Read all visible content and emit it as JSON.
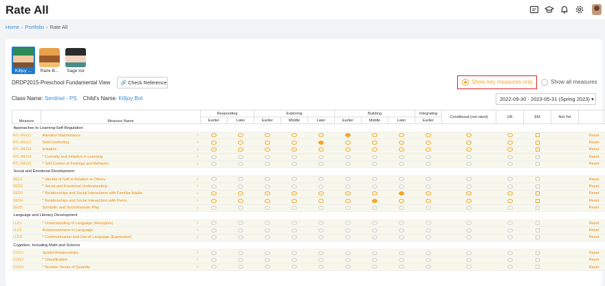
{
  "app": {
    "title": "Rate All"
  },
  "breadcrumb": [
    "Home",
    "Portfolio",
    "Rate All"
  ],
  "children": [
    {
      "name": "Killjoy ...",
      "selected": true
    },
    {
      "name": "Raze B...",
      "selected": false
    },
    {
      "name": "Sage Ice",
      "selected": false
    }
  ],
  "view": {
    "title": "DRDP2015-Preschool Fundamental View",
    "check_reference": "Check Reference"
  },
  "options": {
    "key_only": "Show key measures only",
    "all": "Show all measures"
  },
  "class": {
    "label": "Class Name:",
    "value": "Sentinel - PS",
    "child_label": "Child's Name:",
    "child_value": "Killjoy Bot"
  },
  "date_range": "2022-09-30 - 2023-05-31 (Spring 2023)",
  "table": {
    "groups": [
      "Responding",
      "Exploring",
      "Building",
      "Integrating"
    ],
    "headers": {
      "measure": "Measure",
      "measure_name": "Measure Name",
      "earlier": "Earlier",
      "later": "Later",
      "middle": "Middle",
      "conditional": "Conditional (not rated)",
      "ur": "UR",
      "em": "EM",
      "not_yet": "Not Yet"
    },
    "reset_label": "Reset",
    "sections": [
      {
        "title": "Approaches to Learning-Self-Regulation",
        "rows": [
          {
            "code": "ATL-REG1",
            "name": "Attention Maintenance",
            "key": true,
            "filled": [
              5
            ]
          },
          {
            "code": "ATL-REG2",
            "name": "Self-Comforting",
            "key": true,
            "filled": [
              4
            ]
          },
          {
            "code": "ATL-REG3",
            "name": "Imitation",
            "key": true,
            "filled": []
          },
          {
            "code": "ATL-REG4",
            "name": "* Curiosity and Initiative in Learning",
            "key": false,
            "filled": []
          },
          {
            "code": "ATL-REG5",
            "name": "* Self-Control of Feelings and Behavior",
            "key": false,
            "filled": []
          }
        ]
      },
      {
        "title": "Social and Emotional Development",
        "rows": [
          {
            "code": "SED1",
            "name": "* Identity of Self in Relation to Others",
            "key": false,
            "filled": []
          },
          {
            "code": "SED2",
            "name": "* Social and Emotional Understanding",
            "key": false,
            "filled": []
          },
          {
            "code": "SED3",
            "name": "* Relationships and Social Interactions with Familiar Adults",
            "key": true,
            "filled": [
              7
            ]
          },
          {
            "code": "SED4",
            "name": "* Relationships and Social Interactions with Peers",
            "key": true,
            "filled": [
              6
            ]
          },
          {
            "code": "SED5",
            "name": "Symbolic and Sociodramatic Play",
            "key": false,
            "filled": []
          }
        ]
      },
      {
        "title": "Language and Literacy Development",
        "rows": [
          {
            "code": "LLD1",
            "name": "* Understanding of Language (Receptive)",
            "key": false,
            "filled": []
          },
          {
            "code": "LLD2",
            "name": "Responsiveness to Language",
            "key": false,
            "filled": []
          },
          {
            "code": "LLD3",
            "name": "* Communication and Use of Language (Expressive)",
            "key": false,
            "filled": []
          }
        ]
      },
      {
        "title": "Cognition, Including Math and Science",
        "rows": [
          {
            "code": "COG1",
            "name": "Spatial Relationships",
            "key": false,
            "filled": []
          },
          {
            "code": "COG2",
            "name": "* Classification",
            "key": false,
            "filled": []
          },
          {
            "code": "COG3",
            "name": "* Number Sense of Quantity",
            "key": false,
            "filled": []
          }
        ]
      }
    ]
  },
  "colors": {
    "accent": "#f5a623",
    "link": "#3a8cd6",
    "selected": "#1f7ac9",
    "highlight_border": "#e02020"
  }
}
